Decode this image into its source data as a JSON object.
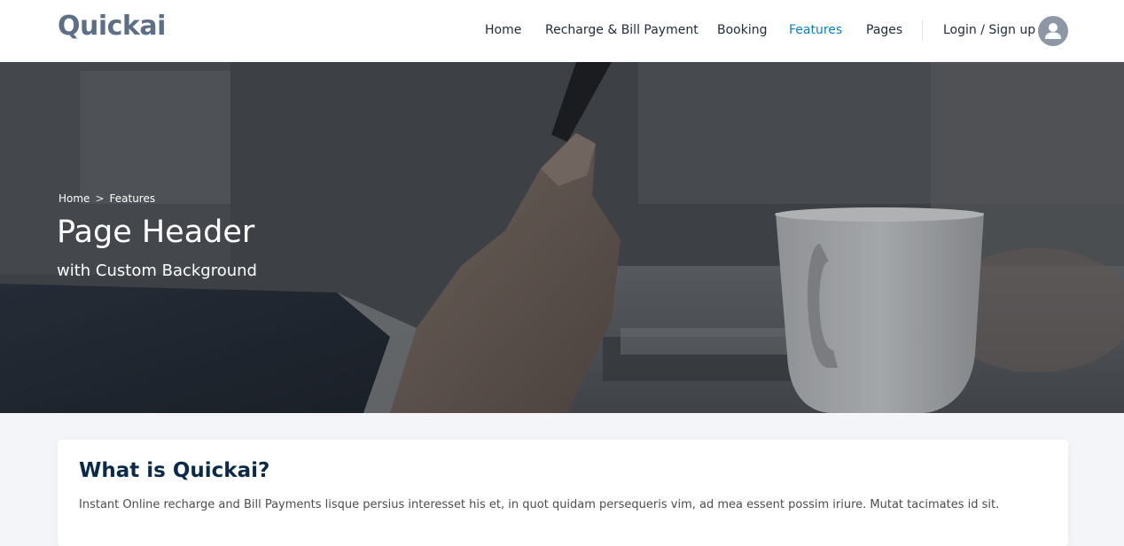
{
  "brand": {
    "name": "Quickai"
  },
  "nav": {
    "items": [
      {
        "label": "Home"
      },
      {
        "label": "Recharge & Bill Payment"
      },
      {
        "label": "Booking"
      },
      {
        "label": "Features"
      },
      {
        "label": "Pages"
      }
    ],
    "active": "Features",
    "login_label": "Login / Sign up",
    "avatar_icon": "user-icon"
  },
  "hero": {
    "breadcrumb": [
      {
        "label": "Home"
      },
      {
        "label": "Features"
      }
    ],
    "breadcrumb_separator": ">",
    "title": "Page Header",
    "subtitle": "with Custom Background"
  },
  "content": {
    "title": "What is Quickai?",
    "text": "Instant Online recharge and Bill Payments lisque persius interesset his et, in quot quidam persequeris vim, ad mea essent possim iriure. Mutat tacimates id sit."
  },
  "colors": {
    "accent": "#0c7ec8",
    "nav_text": "#1e2a3a",
    "logo": "#5d6f86",
    "heading": "#0b2a4a"
  }
}
